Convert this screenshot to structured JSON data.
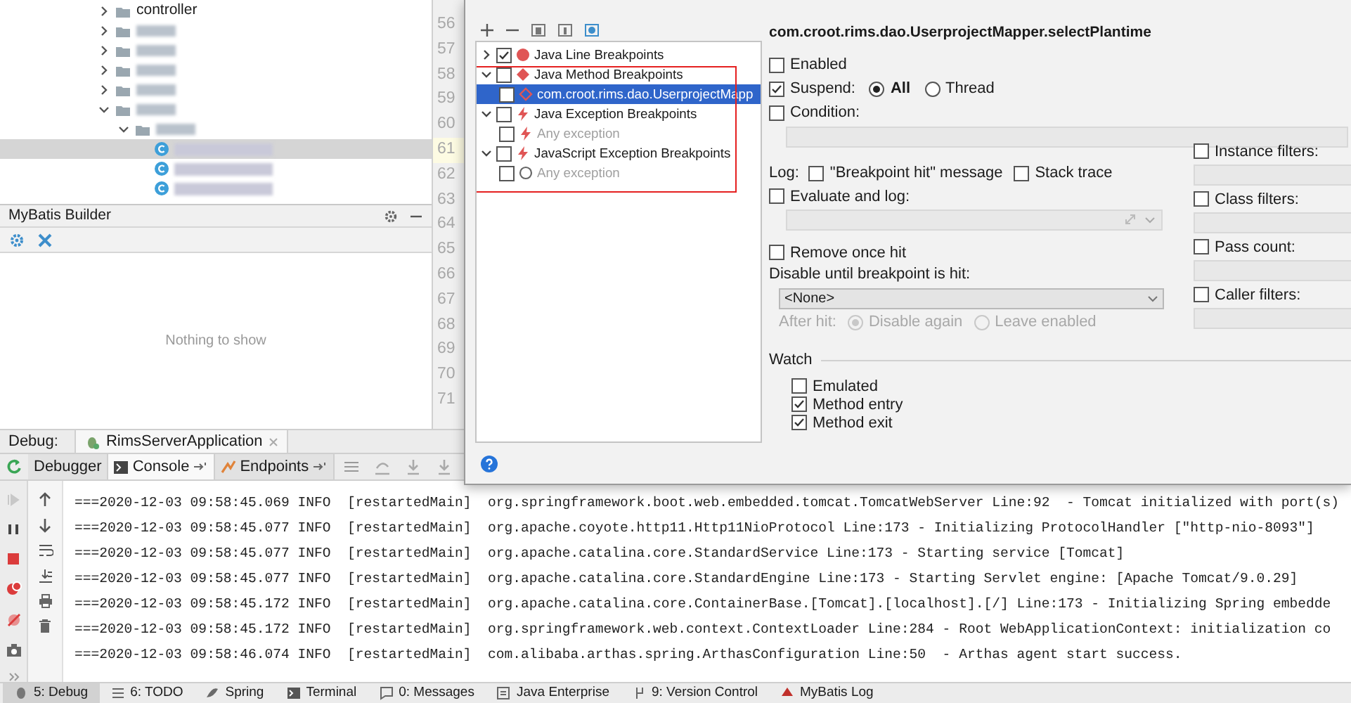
{
  "project_tree": {
    "items": [
      {
        "kind": "folder",
        "label": "controller",
        "expanded": false
      },
      {
        "kind": "redacted",
        "expanded": false
      },
      {
        "kind": "redacted",
        "expanded": false
      },
      {
        "kind": "redacted",
        "expanded": false
      },
      {
        "kind": "redacted",
        "expanded": false
      },
      {
        "kind": "redacted",
        "expanded": true,
        "children": [
          {
            "kind": "redacted",
            "expanded": true,
            "children": [
              {
                "kind": "class",
                "selected": true
              },
              {
                "kind": "class",
                "selected": false
              },
              {
                "kind": "class",
                "selected": false
              }
            ]
          }
        ]
      }
    ]
  },
  "editor_gutter": [
    {
      "number": "56",
      "current": false
    },
    {
      "number": "57",
      "current": false
    },
    {
      "number": "58",
      "current": false
    },
    {
      "number": "59",
      "current": false
    },
    {
      "number": "60",
      "current": false
    },
    {
      "number": "61",
      "current": true
    },
    {
      "number": "62",
      "current": false
    },
    {
      "number": "63",
      "current": false
    },
    {
      "number": "64",
      "current": false
    },
    {
      "number": "65",
      "current": false
    },
    {
      "number": "66",
      "current": false
    },
    {
      "number": "67",
      "current": false
    },
    {
      "number": "68",
      "current": false
    },
    {
      "number": "69",
      "current": false
    },
    {
      "number": "70",
      "current": false
    },
    {
      "number": "71",
      "current": false
    }
  ],
  "mybatis_builder": {
    "title": "MyBatis Builder",
    "empty_text": "Nothing to show"
  },
  "debug_bar": {
    "label": "Debug:",
    "session_tab": "RimsServerApplication"
  },
  "debug_tabs": [
    {
      "label": "Debugger",
      "selected": false,
      "kind": "plain"
    },
    {
      "label": "Console",
      "selected": true,
      "kind": "console"
    },
    {
      "label": "Endpoints",
      "selected": false,
      "kind": "endpoints"
    }
  ],
  "console_lines": [
    "===2020-12-03 09:58:45.069 INFO  [restartedMain]  org.springframework.boot.web.embedded.tomcat.TomcatWebServer Line:92  - Tomcat initialized with port(s)",
    "===2020-12-03 09:58:45.077 INFO  [restartedMain]  org.apache.coyote.http11.Http11NioProtocol Line:173 - Initializing ProtocolHandler [\"http-nio-8093\"]",
    "===2020-12-03 09:58:45.077 INFO  [restartedMain]  org.apache.catalina.core.StandardService Line:173 - Starting service [Tomcat]",
    "===2020-12-03 09:58:45.077 INFO  [restartedMain]  org.apache.catalina.core.StandardEngine Line:173 - Starting Servlet engine: [Apache Tomcat/9.0.29]",
    "===2020-12-03 09:58:45.172 INFO  [restartedMain]  org.apache.catalina.core.ContainerBase.[Tomcat].[localhost].[/] Line:173 - Initializing Spring embedde",
    "===2020-12-03 09:58:45.172 INFO  [restartedMain]  org.springframework.web.context.ContextLoader Line:284 - Root WebApplicationContext: initialization co",
    "===2020-12-03 09:58:46.074 INFO  [restartedMain]  com.alibaba.arthas.spring.ArthasConfiguration Line:50  - Arthas agent start success."
  ],
  "breakpoints_dialog": {
    "tree": [
      {
        "label": "Java Line Breakpoints",
        "kind": "dot",
        "checked": true,
        "expanded": false,
        "selected": false,
        "disabled": false
      },
      {
        "label": "Java Method Breakpoints",
        "kind": "diamond",
        "checked": false,
        "expanded": true,
        "selected": false,
        "disabled": false,
        "children": [
          {
            "label": "com.croot.rims.dao.UserprojectMapp",
            "kind": "hollow-diamond",
            "checked": false,
            "selected": true,
            "disabled": false
          }
        ]
      },
      {
        "label": "Java Exception Breakpoints",
        "kind": "lightning",
        "checked": false,
        "expanded": true,
        "selected": false,
        "disabled": false,
        "children": [
          {
            "label": "Any exception",
            "kind": "lightning",
            "checked": false,
            "selected": false,
            "disabled": true
          }
        ]
      },
      {
        "label": "JavaScript Exception Breakpoints",
        "kind": "lightning",
        "checked": false,
        "expanded": true,
        "selected": false,
        "disabled": false,
        "children": [
          {
            "label": "Any exception",
            "kind": "circle",
            "checked": false,
            "selected": false,
            "disabled": true
          }
        ]
      }
    ],
    "details": {
      "title": "com.croot.rims.dao.UserprojectMapper.selectPlantime",
      "enabled": {
        "label": "Enabled",
        "checked": false
      },
      "suspend": {
        "label": "Suspend:",
        "checked": true,
        "options": [
          {
            "label": "All",
            "selected": true
          },
          {
            "label": "Thread",
            "selected": false
          }
        ]
      },
      "condition": {
        "label": "Condition:",
        "checked": false
      },
      "log": {
        "label": "Log:",
        "options": [
          {
            "label": "\"Breakpoint hit\" message",
            "checked": false
          },
          {
            "label": "Stack trace",
            "checked": false
          }
        ]
      },
      "evaluate_and_log": {
        "label": "Evaluate and log:",
        "checked": false
      },
      "remove_once_hit": {
        "label": "Remove once hit",
        "checked": false
      },
      "disable_until": {
        "label": "Disable until breakpoint is hit:",
        "value": "<None>"
      },
      "after_hit": {
        "label": "After hit:",
        "disabled": true,
        "options": [
          {
            "label": "Disable again",
            "selected": true
          },
          {
            "label": "Leave enabled",
            "selected": false
          }
        ]
      },
      "filters": [
        {
          "label": "Instance filters:",
          "checked": false
        },
        {
          "label": "Class filters:",
          "checked": false
        },
        {
          "label": "Pass count:",
          "checked": false
        },
        {
          "label": "Caller filters:",
          "checked": false
        }
      ],
      "watch": {
        "label": "Watch",
        "options": [
          {
            "label": "Emulated",
            "checked": false
          },
          {
            "label": "Method entry",
            "checked": true
          },
          {
            "label": "Method exit",
            "checked": true
          }
        ]
      }
    }
  },
  "status_bar": [
    {
      "label": "5: Debug",
      "selected": true
    },
    {
      "label": "6: TODO",
      "selected": false
    },
    {
      "label": "Spring",
      "selected": false
    },
    {
      "label": "Terminal",
      "selected": false
    },
    {
      "label": "0: Messages",
      "selected": false
    },
    {
      "label": "Java Enterprise",
      "selected": false
    },
    {
      "label": "9: Version Control",
      "selected": false
    },
    {
      "label": "MyBatis Log",
      "selected": false
    }
  ]
}
